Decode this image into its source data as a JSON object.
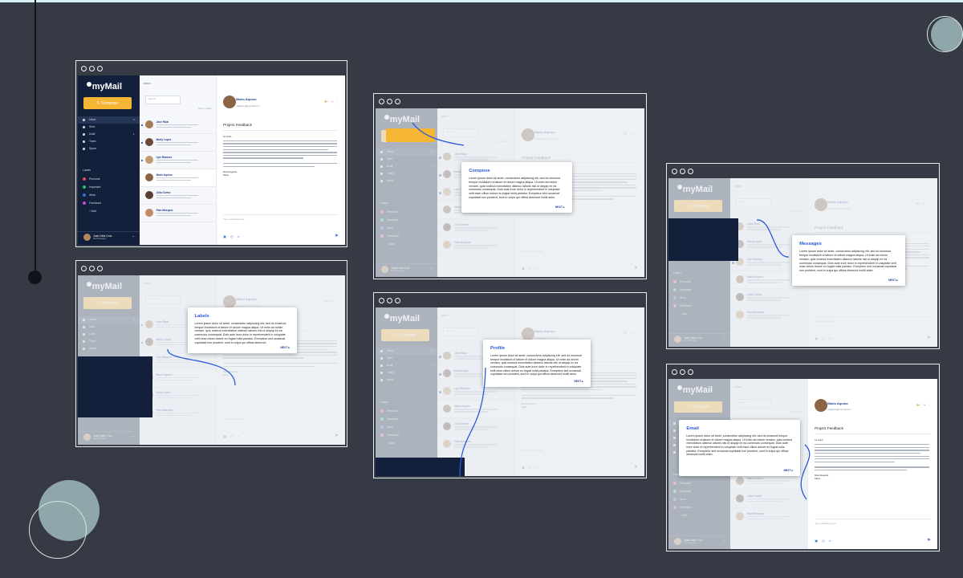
{
  "app": {
    "logo": "myMail",
    "compose_label": "✎ Compose",
    "list_title": "Inbox",
    "search_placeholder": "Search...",
    "sort_label": "Sort by: Date ▾",
    "nav": [
      {
        "label": "Inbox",
        "count": "4"
      },
      {
        "label": "Sent",
        "count": ""
      },
      {
        "label": "Draft",
        "count": "1"
      },
      {
        "label": "Trash",
        "count": ""
      },
      {
        "label": "Spam",
        "count": ""
      }
    ],
    "labels_heading": "Labels",
    "labels": [
      {
        "label": "Personal",
        "color": "#e8475f"
      },
      {
        "label": "Important",
        "color": "#2fc06b"
      },
      {
        "label": "Work",
        "color": "#3a6fd8"
      },
      {
        "label": "Freelance",
        "color": "#c54bd1"
      },
      {
        "label": "+  Add",
        "color": "#13203b"
      }
    ],
    "profile": {
      "name": "Juan Dela Cruz",
      "role": "Web Designer"
    },
    "messages": [
      {
        "name": "Jose Rizal"
      },
      {
        "name": "Marty Lopez"
      },
      {
        "name": "Lyle Ramirez"
      },
      {
        "name": "Mario Aquino"
      },
      {
        "name": "Julia Cortez"
      },
      {
        "name": "Pam Mosqera"
      }
    ],
    "reader": {
      "sender": "Mario Aquino",
      "email": "mtaguino@mymail.com",
      "subject": "Project Feedback",
      "greeting": "Hi Juan,",
      "sign_off": "Best Regards,",
      "sign_name": "Mario",
      "reply_placeholder": "Type something here..."
    }
  },
  "tooltips": {
    "compose": {
      "title": "Compose",
      "body": "Lorem ipsum dolor sit amet, consectetur adipiscing elit, sed do eiusmod tempor incididunt ut labore et dolore magna aliqua. Ut enim ad minim veniam, quis nostrud exercitation ullamco laboris nisi ut aliquip ex ea commodo consequat. Duis aute irure dolor in reprehenderit in voluptate velit esse cillum dolore eu fugiat nulla pariatur. Excepteur sint occaecat cupidatat non proident, sunt in culpa qui officia deserunt mollit anim.",
      "next": "NEXT ▸"
    },
    "messages": {
      "title": "Messages",
      "body": "Lorem ipsum dolor sit amet, consectetur adipiscing elit, sed do eiusmod tempor incididunt ut labore et dolore magna aliqua. Ut enim ad minim veniam, quis nostrud exercitation ullamco laboris nisi ut aliquip ex ea commodo consequat. Duis aute irure dolor in reprehenderit in voluptate velit esse cillum dolore eu fugiat nulla pariatur. Excepteur sint occaecat cupidatat non proident, sunt in culpa qui officia deserunt mollit anim.",
      "next": "NEXT ▸"
    },
    "labels": {
      "title": "Labels",
      "body": "Lorem ipsum dolor sit amet, consectetur adipiscing elit, sed do eiusmod tempor incididunt ut labore et dolore magna aliqua. Ut enim ad minim veniam, quis nostrud exercitation ullamco laboris nisi ut aliquip ex ea commodo consequat. Duis aute irure dolor in reprehenderit in voluptate velit esse cillum dolore eu fugiat nulla pariatur. Excepteur sint occaecat cupidatat non proident, sunt in culpa qui officia deserunt.",
      "next": "NEXT ▸"
    },
    "profile": {
      "title": "Profile",
      "body": "Lorem ipsum dolor sit amet, consectetur adipiscing elit, sed do eiusmod tempor incididunt ut labore et dolore magna aliqua. Ut enim ad minim veniam, quis nostrud exercitation ullamco laboris nisi ut aliquip ex ea commodo consequat. Duis aute irure dolor in reprehenderit in voluptate velit esse cillum dolore eu fugiat nulla pariatur. Excepteur sint occaecat cupidatat non proident, sunt in culpa qui officia deserunt mollit anim.",
      "next": "NEXT ▸"
    },
    "email": {
      "title": "Email",
      "body": "Lorem ipsum dolor sit amet, consectetur adipiscing elit, sed do eiusmod tempor incididunt ut labore et dolore magna aliqua. Ut enim ad minim veniam, quis nostrud exercitation ullamco laboris nisi ut aliquip ex ea commodo consequat. Duis aute irure dolor in reprehenderit in voluptate velit esse cillum dolore eu fugiat nulla pariatur. Excepteur sint occaecat cupidatat non proident, sunt in culpa qui officia deserunt mollit anim.",
      "next": "NEXT ▸"
    }
  },
  "colors": {
    "background": "#353a44",
    "sidebar": "#13203b",
    "accent": "#f7b534",
    "highlight": "#2a5bd7"
  }
}
